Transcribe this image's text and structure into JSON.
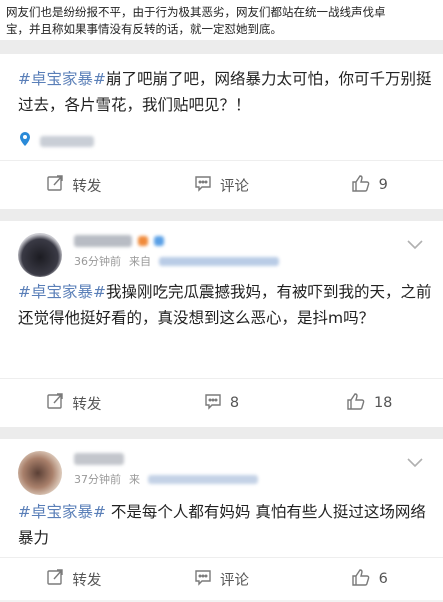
{
  "intro": {
    "line1": "网友们也是纷纷报不平，由于行为极其恶劣，网友们都站在统一战线声伐卓",
    "line2": "宝，并且称如果事情没有反转的话，就一定怼她到底。"
  },
  "posts": [
    {
      "hashtag": "#卓宝家暴#",
      "text": "崩了吧崩了吧，网络暴力太可怕，你可千万别挺过去，各片雪花，我们贴吧见？！",
      "repost_label": "转发",
      "comment_label": "评论",
      "like_count": "9"
    },
    {
      "time": "36分钟前",
      "source": "来自",
      "hashtag": "#卓宝家暴#",
      "text": "我操刚吃完瓜震撼我妈，有被吓到我的天，之前还觉得他挺好看的，真没想到这么恶心，是抖m吗？",
      "repost_label": "转发",
      "comment_count": "8",
      "like_count": "18"
    },
    {
      "time": "37分钟前",
      "source": "来",
      "hashtag": "#卓宝家暴#",
      "text": " 不是每个人都有妈妈 真怕有些人挺过这场网络暴力",
      "repost_label": "转发",
      "comment_label": "评论",
      "like_count": "6"
    }
  ],
  "colors": {
    "hashtag": "#5a7fb8",
    "icon": "#7a7a7a"
  }
}
